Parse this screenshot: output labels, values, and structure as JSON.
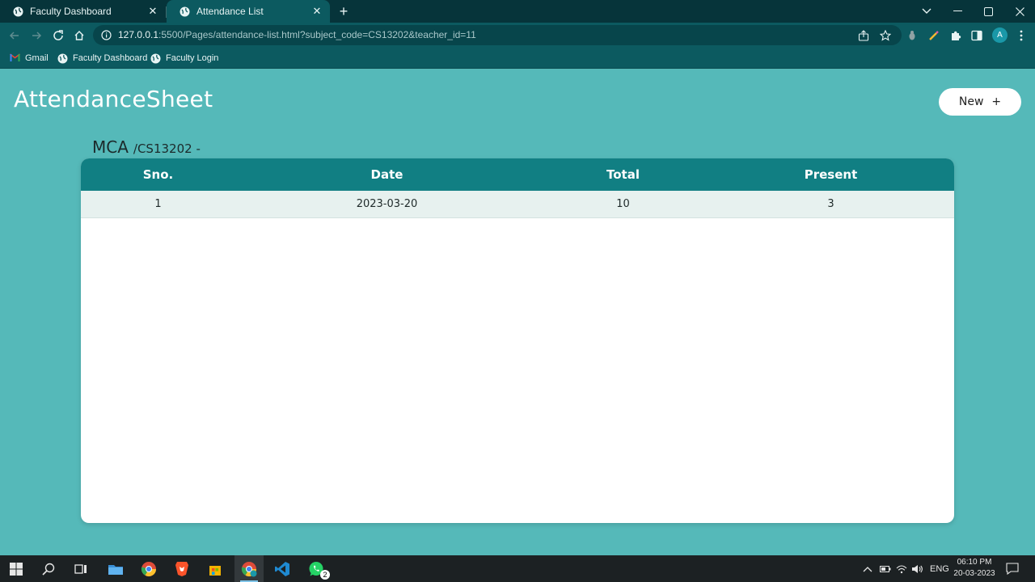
{
  "browser": {
    "tabs": [
      {
        "title": "Faculty Dashboard",
        "active": false
      },
      {
        "title": "Attendance List",
        "active": true
      }
    ],
    "url_host": "127.0.0.1",
    "url_rest": ":5500/Pages/attendance-list.html?subject_code=CS13202&teacher_id=11",
    "profile_initial": "A",
    "bookmarks": [
      "Gmail",
      "Faculty Dashboard",
      "Faculty Login"
    ]
  },
  "page": {
    "brand": "AttendanceSheet",
    "new_button_label": "New",
    "new_button_icon": "+",
    "course": "MCA",
    "subject_code": "/CS13202 -",
    "table": {
      "headers": [
        "Sno.",
        "Date",
        "Total",
        "Present"
      ],
      "rows": [
        [
          "1",
          "2023-03-20",
          "10",
          "3"
        ]
      ]
    }
  },
  "taskbar": {
    "language": "ENG",
    "time": "06:10 PM",
    "date": "20-03-2023",
    "whatsapp_badge": "2"
  },
  "colors": {
    "page_bg": "#55b9b9",
    "table_header": "#117f83",
    "chrome_frame": "#06343a"
  }
}
